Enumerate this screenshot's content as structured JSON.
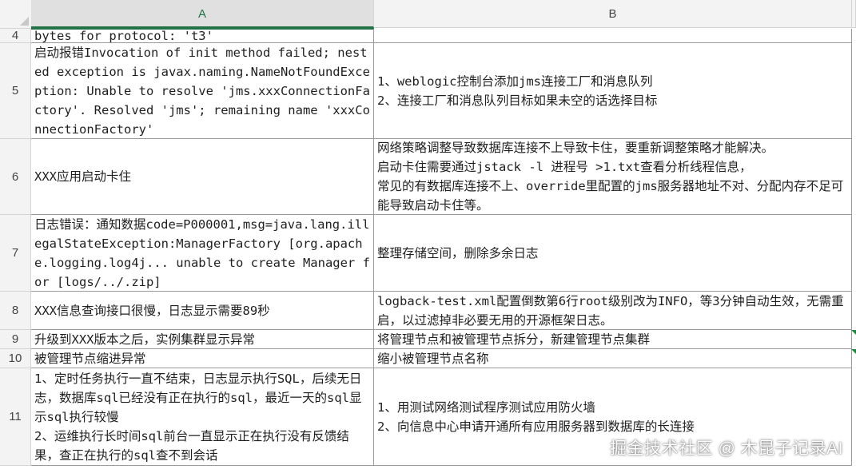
{
  "columns": [
    "A",
    "B"
  ],
  "rows": [
    {
      "num": "4",
      "a": "bytes for protocol: 't3'",
      "b": ""
    },
    {
      "num": "5",
      "a": "启动报错Invocation of init method failed; nested exception is javax.naming.NameNotFoundException: Unable to resolve 'jms.xxxConnectionFactory'. Resolved 'jms'; remaining name 'xxxConnectionFactory'",
      "b": "1、weblogic控制台添加jms连接工厂和消息队列\n2、连接工厂和消息队列目标如果未空的话选择目标"
    },
    {
      "num": "6",
      "a": "XXX应用启动卡住",
      "b": "网络策略调整导致数据库连接不上导致卡住，要重新调整策略才能解决。\n启动卡住需要通过jstack -l 进程号 >1.txt查看分析线程信息，\n常见的有数据库连接不上、override里配置的jms服务器地址不对、分配内存不足可能导致启动卡住等。"
    },
    {
      "num": "7",
      "a": "日志错误：通知数据code=P000001,msg=java.lang.illegalStateException:ManagerFactory [org.apache.logging.log4j... unable to create Manager for [logs/../.zip]",
      "b": "整理存储空间，删除多余日志"
    },
    {
      "num": "8",
      "a": "XXX信息查询接口很慢，日志显示需要89秒",
      "b": "logback-test.xml配置倒数第6行root级别改为INFO，等3分钟自动生效，无需重启，以过滤掉非必要无用的开源框架日志。"
    },
    {
      "num": "9",
      "a": "升级到XXX版本之后，实例集群显示异常",
      "b": "将管理节点和被管理节点拆分，新建管理节点集群"
    },
    {
      "num": "10",
      "a": "被管理节点缩进异常",
      "b": "缩小被管理节点名称"
    },
    {
      "num": "11",
      "a": "1、定时任务执行一直不结束，日志显示执行SQL，后续无日志，数据库sql已经没有正在执行的sql，最近一天的sql显示sql执行较慢\n2、运维执行长时间sql前台一直显示正在执行没有反馈结果，查正在执行的sql查不到会话",
      "b": "1、用测试网络测试程序测试应用防火墙\n2、向信息中心申请开通所有应用服务器到数据库的长连接"
    }
  ],
  "watermark": "掘金技术社区 @ 木昆子记录AI"
}
